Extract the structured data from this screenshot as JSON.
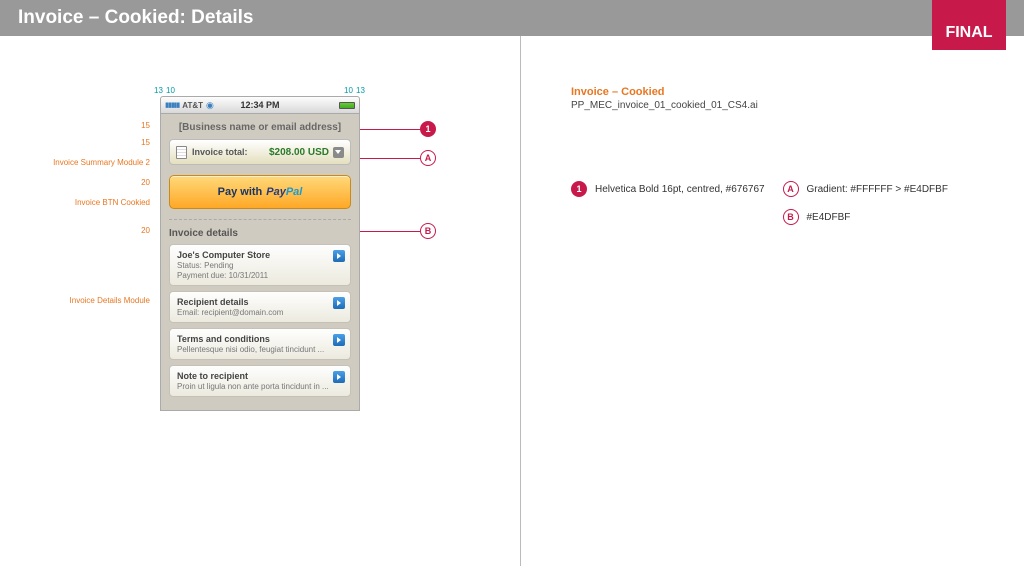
{
  "header": {
    "title": "Invoice – Cookied: Details",
    "final": "FINAL"
  },
  "dims": {
    "top_left_a": "13",
    "top_left_b": "10",
    "top_right_a": "10",
    "top_right_b": "13",
    "gap_15a": "15",
    "gap_15b": "15",
    "gap_20a": "20",
    "gap_20b": "20"
  },
  "redlines": {
    "summary": "Invoice Summary Module 2",
    "btn": "Invoice BTN Cookied",
    "details": "Invoice Details Module"
  },
  "statusbar": {
    "carrier": "AT&T",
    "time": "12:34 PM"
  },
  "app": {
    "business": "[Business name or email address]",
    "total_label": "Invoice total:",
    "total_value": "$208.00 USD",
    "pay_prefix": "Pay with ",
    "details_header": "Invoice details",
    "cards": [
      {
        "title": "Joe's Computer Store",
        "line1": "Status: Pending",
        "line2": "Payment due: 10/31/2011"
      },
      {
        "title": "Recipient details",
        "line1": "Email: recipient@domain.com",
        "line2": ""
      },
      {
        "title": "Terms and conditions",
        "line1": "Pellentesque nisi odio, feugiat tincidunt ...",
        "line2": ""
      },
      {
        "title": "Note to recipient",
        "line1": "Proin ut ligula non ante porta tincidunt in ...",
        "line2": ""
      }
    ]
  },
  "callouts": {
    "one": "1",
    "a": "A",
    "b": "B"
  },
  "spec": {
    "title": "Invoice – Cookied",
    "file": "PP_MEC_invoice_01_cookied_01_CS4.ai",
    "notes": {
      "one": "Helvetica Bold 16pt, centred, #676767",
      "a": "Gradient: #FFFFFF > #E4DFBF",
      "b": "#E4DFBF"
    }
  }
}
